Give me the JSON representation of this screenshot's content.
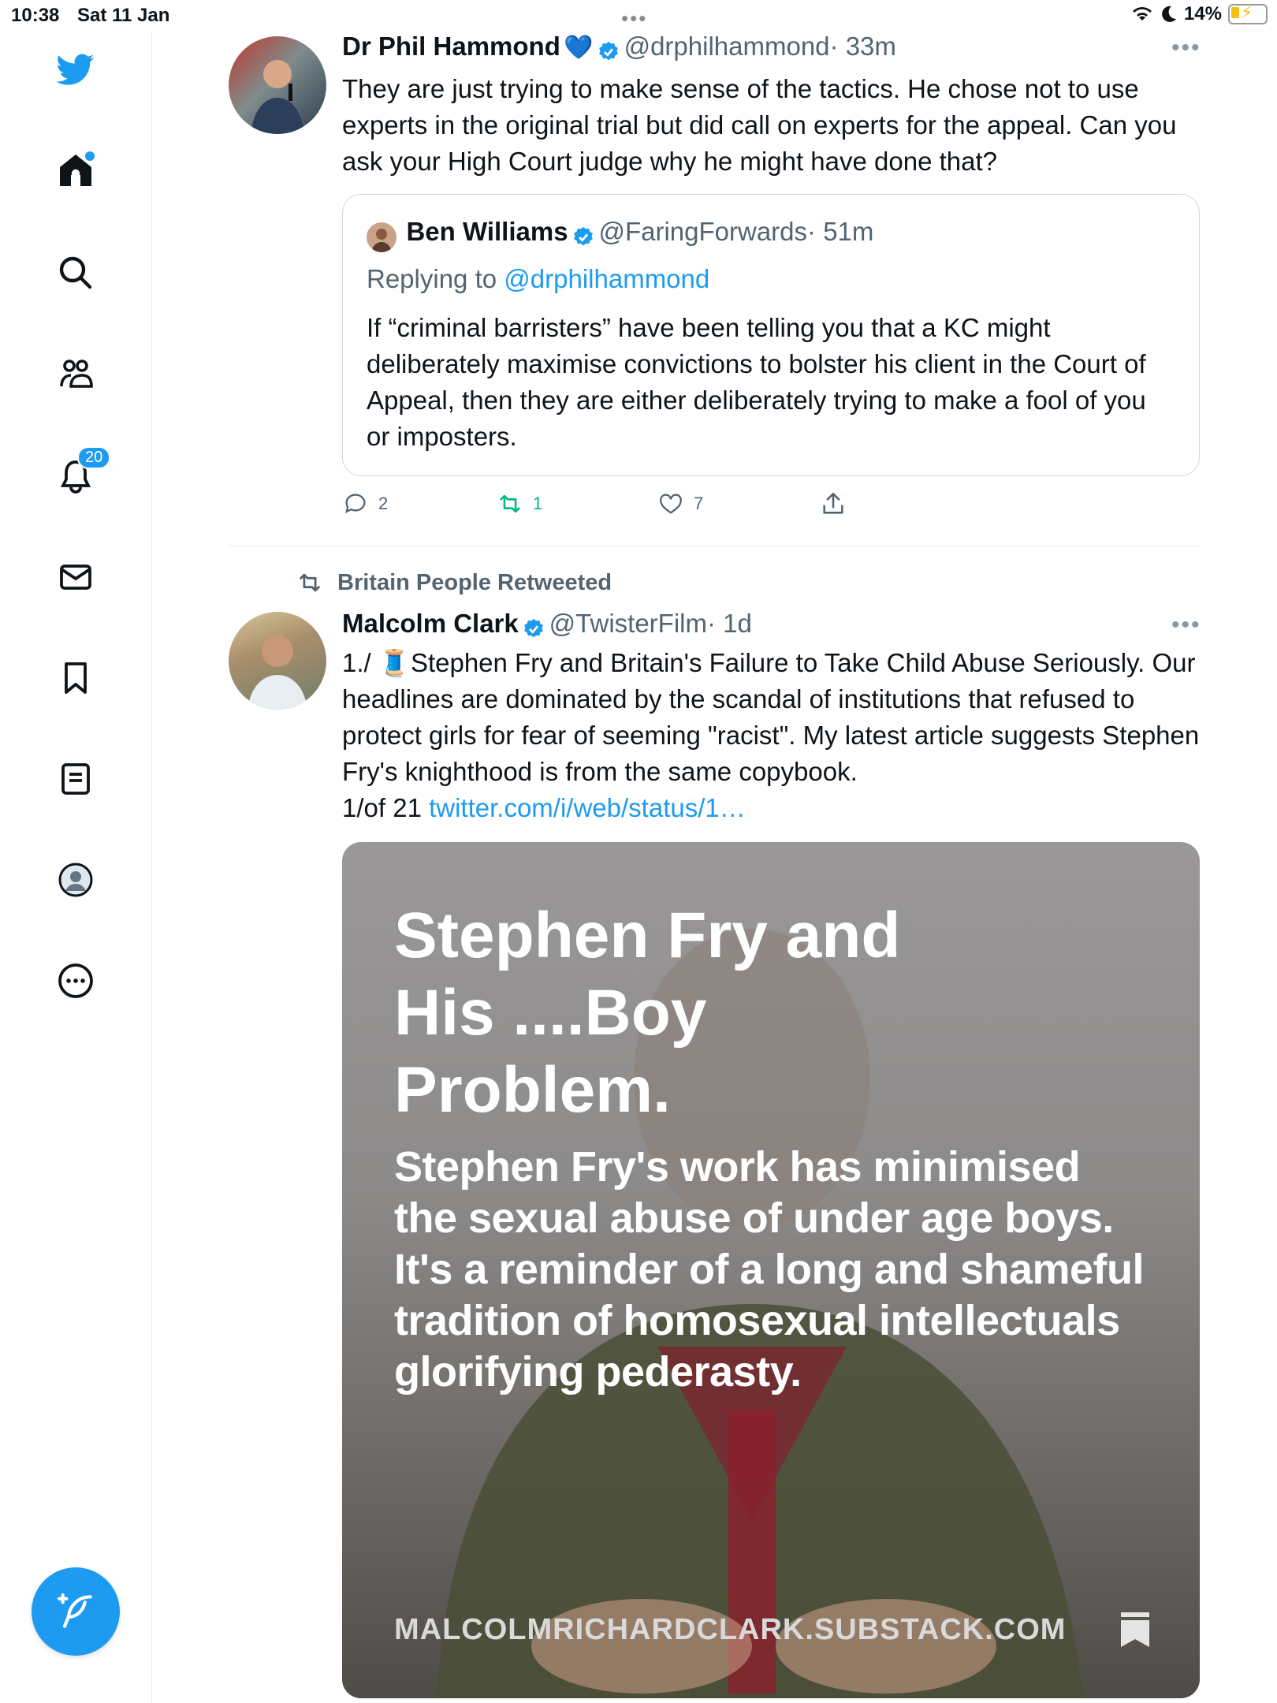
{
  "status_bar": {
    "time": "10:38",
    "date": "Sat 11 Jan",
    "battery": "14%"
  },
  "sidebar": {
    "items": [
      {
        "name": "twitter-logo-icon"
      },
      {
        "name": "home-icon"
      },
      {
        "name": "search-icon"
      },
      {
        "name": "communities-icon"
      },
      {
        "name": "notifications-icon",
        "badge": "20"
      },
      {
        "name": "messages-icon"
      },
      {
        "name": "bookmarks-icon"
      },
      {
        "name": "lists-icon"
      },
      {
        "name": "profile-icon"
      },
      {
        "name": "more-icon"
      }
    ],
    "compose": "compose-icon"
  },
  "tweet1": {
    "name": "Dr Phil Hammond",
    "emoji": "💙",
    "handle": "@drphilhammond",
    "time": "· 33m",
    "text": "They are just trying to make sense of the tactics. He chose not to use experts in the original trial but did call on experts for the appeal. Can you ask your High Court judge why he might have done that?",
    "quote": {
      "name": "Ben Williams",
      "handle": "@FaringForwards",
      "time": "· 51m",
      "replying_to_label": "Replying to",
      "replying_to_handle": "@drphilhammond",
      "text": "If “criminal barristers” have been telling you that a KC might deliberately maximise convictions to bolster his client in the Court of Appeal, then they are either deliberately trying to make a fool of you or imposters."
    },
    "replies": "2",
    "retweets": "1",
    "likes": "7"
  },
  "tweet2": {
    "retweeted_by": "Britain People Retweeted",
    "name": "Malcolm Clark",
    "handle": "@TwisterFilm",
    "time": "· 1d",
    "text_prefix": "1./ 🧵Stephen Fry and Britain's Failure to Take Child Abuse Seriously. Our headlines are dominated by the scandal of institutions that refused to protect girls for fear of seeming \"racist\". My latest article suggests Stephen Fry's knighthood is from the same copybook.",
    "text_line2": "1/of 21 ",
    "link": "twitter.com/i/web/status/1…",
    "card": {
      "title": "Stephen Fry and His ....Boy Problem.",
      "subtitle": "Stephen Fry's work has minimised the sexual abuse of under age boys. It's a reminder of a long and shameful tradition of homosexual intellectuals glorifying pederasty.",
      "domain": "MALCOLMRICHARDCLARK.SUBSTACK.COM"
    }
  },
  "colors": {
    "accent": "#1d9bf0",
    "secondary_text": "#536471",
    "retweet_green": "#00ba7c"
  }
}
